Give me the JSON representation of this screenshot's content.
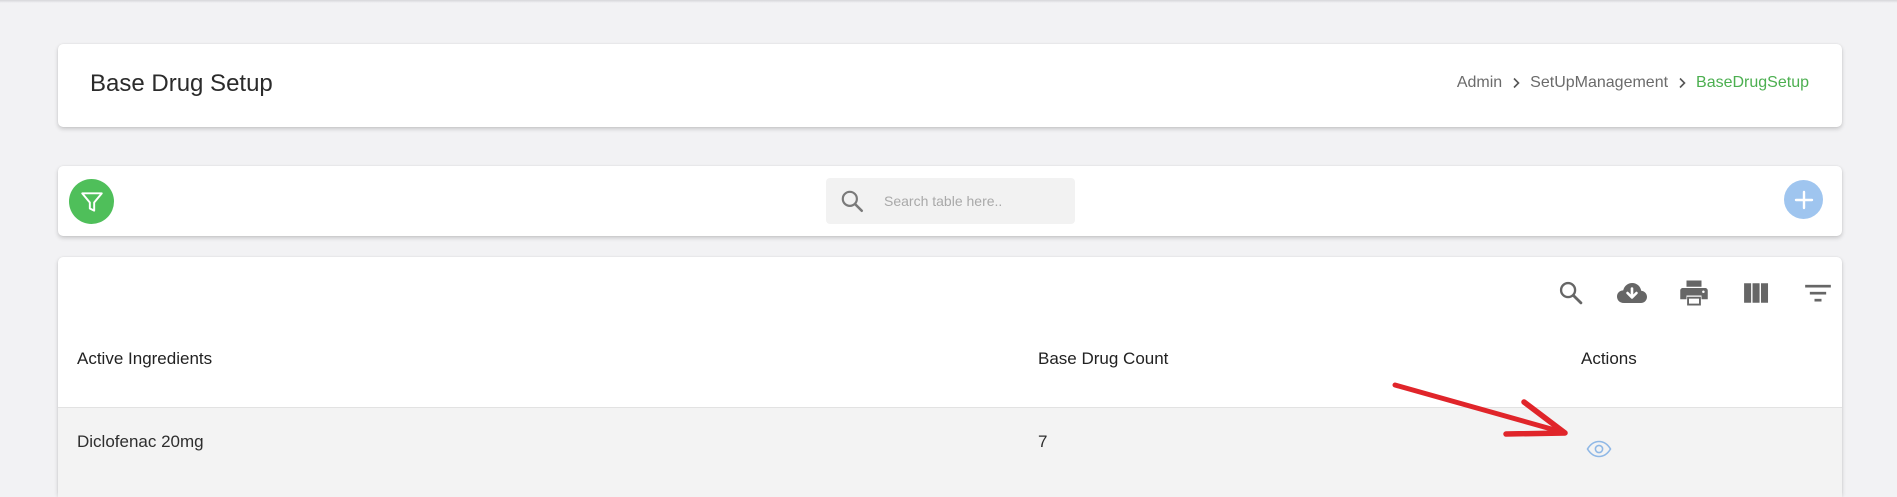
{
  "header": {
    "title": "Base Drug Setup",
    "breadcrumb": [
      "Admin",
      "SetUpManagement",
      "BaseDrugSetup"
    ]
  },
  "toolbar": {
    "filter_icon": "filter-icon",
    "search_placeholder": "Search table here..",
    "add_icon": "plus-icon"
  },
  "table": {
    "tools": [
      "search-icon",
      "cloud-download-icon",
      "print-icon",
      "view-column-icon",
      "filter-list-icon"
    ],
    "columns": [
      "Active Ingredients",
      "Base Drug Count",
      "Actions"
    ],
    "rows": [
      {
        "active_ingredients": "Diclofenac 20mg",
        "base_drug_count": "7",
        "action_icon": "eye-icon"
      }
    ]
  },
  "annotation": {
    "color": "#e0252a"
  },
  "colors": {
    "accent_green": "#4caf50",
    "filter_green": "#4fbf5a",
    "add_blue": "#9fc5ef",
    "eye_blue": "#8fb8e6"
  }
}
